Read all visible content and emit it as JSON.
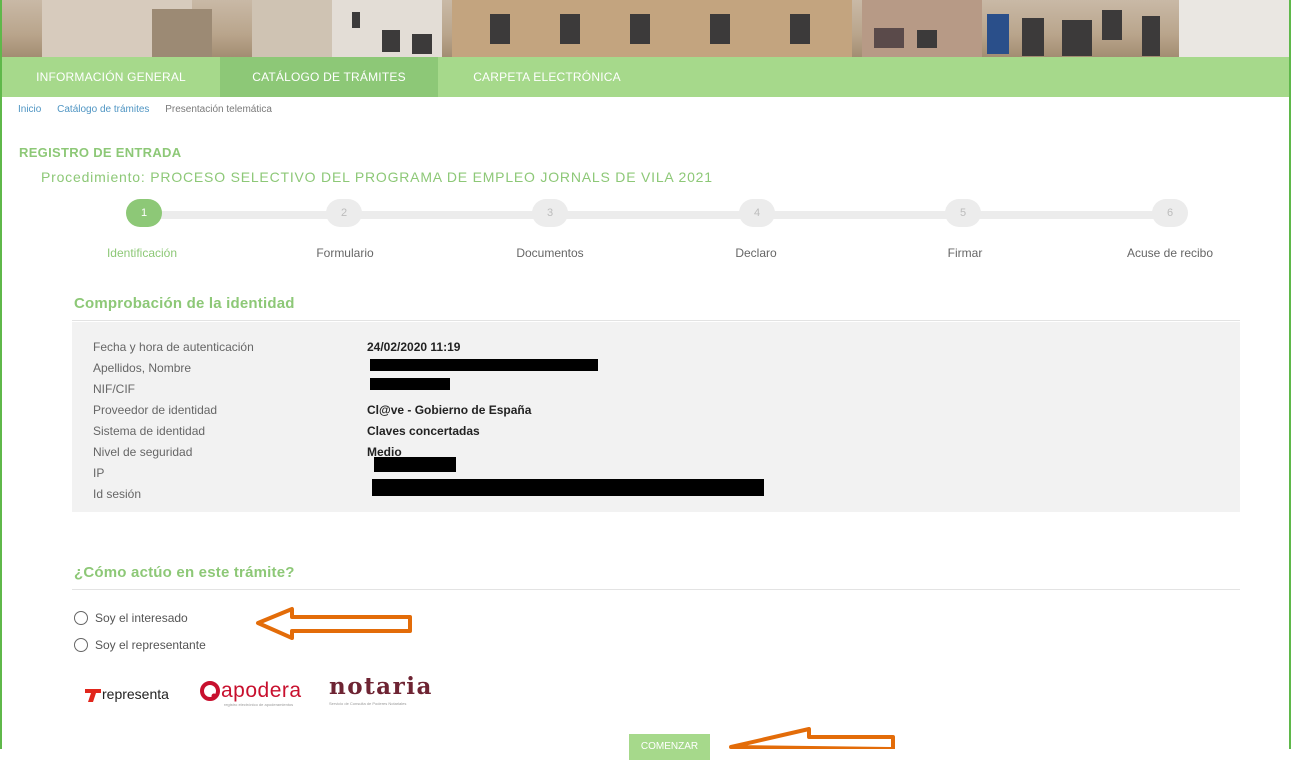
{
  "nav": {
    "items": [
      "INFORMACIÓN GENERAL",
      "CATÁLOGO DE TRÁMITES",
      "CARPETA ELECTRÓNICA"
    ],
    "active_index": 1
  },
  "breadcrumb": [
    "Inicio",
    "Catálogo de trámites",
    "Presentación telemática"
  ],
  "page": {
    "section_title": "REGISTRO DE ENTRADA",
    "procedure": "Procedimiento: PROCESO SELECTIVO DEL PROGRAMA DE EMPLEO JORNALS DE VILA 2021"
  },
  "steps": [
    {
      "num": "1",
      "label": "Identificación"
    },
    {
      "num": "2",
      "label": "Formulario"
    },
    {
      "num": "3",
      "label": "Documentos"
    },
    {
      "num": "4",
      "label": "Declaro"
    },
    {
      "num": "5",
      "label": "Firmar"
    },
    {
      "num": "6",
      "label": "Acuse de recibo"
    }
  ],
  "current_step": 1,
  "identity": {
    "title": "Comprobación de la identidad",
    "rows": [
      {
        "label": "Fecha y hora de autenticación",
        "value": "24/02/2020 11:19"
      },
      {
        "label": "Apellidos, Nombre",
        "value": ""
      },
      {
        "label": "NIF/CIF",
        "value": ""
      },
      {
        "label": "Proveedor de identidad",
        "value": "Cl@ve - Gobierno de España"
      },
      {
        "label": "Sistema de identidad",
        "value": "Claves concertadas"
      },
      {
        "label": "Nivel de seguridad",
        "value": "Medio"
      },
      {
        "label": "IP",
        "value": ""
      },
      {
        "label": "Id sesión",
        "value": ""
      }
    ]
  },
  "acting": {
    "title": "¿Cómo actúo en este trámite?",
    "options": [
      "Soy el interesado",
      "Soy el representante"
    ]
  },
  "logos": {
    "representa": "representa",
    "apodera_main": "apodera",
    "apodera_sub": "registro electrónico de apoderamientos",
    "notaria": "notaria",
    "notaria_sub": "Servicio de Consulta de Poderes Notariales"
  },
  "start_button": "COMENZAR",
  "colors": {
    "brand_green": "#8dc877",
    "nav_green": "#a6d98b",
    "arrow_orange": "#e36c09",
    "link_blue": "#4f95c3"
  }
}
